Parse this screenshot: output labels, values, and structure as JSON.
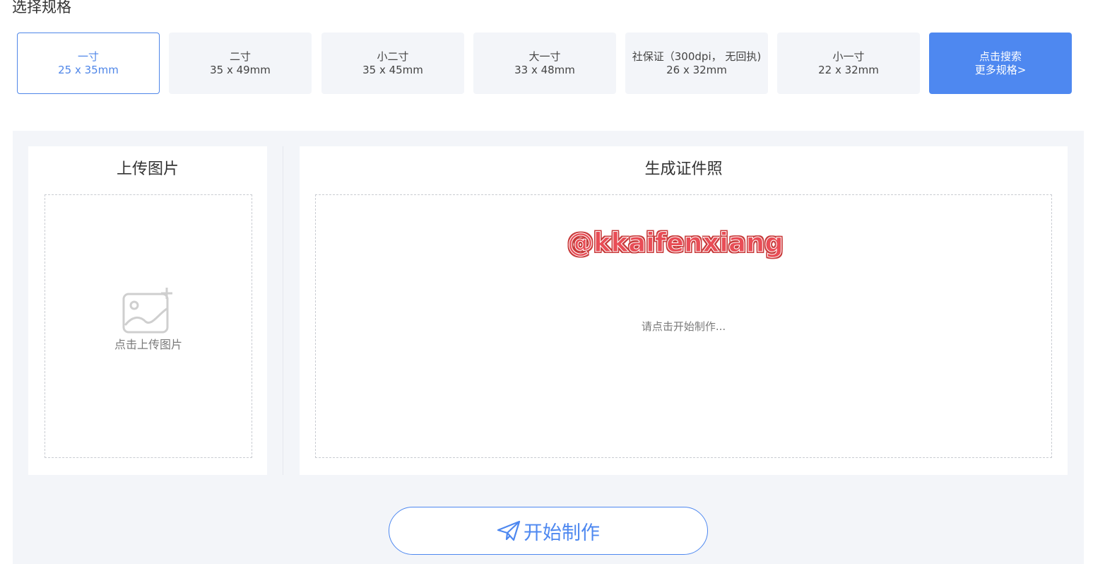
{
  "header": {
    "title": "选择规格"
  },
  "specs": [
    {
      "name": "一寸",
      "size": "25 x 35mm"
    },
    {
      "name": "二寸",
      "size": "35 x 49mm"
    },
    {
      "name": "小二寸",
      "size": "35 x 45mm"
    },
    {
      "name": "大一寸",
      "size": "33 x 48mm"
    },
    {
      "name": "社保证（300dpi， 无回执)",
      "size": "26 x 32mm"
    },
    {
      "name": "小一寸",
      "size": "22 x 32mm"
    }
  ],
  "more_specs": {
    "line1": "点击搜索",
    "line2": "更多规格>"
  },
  "upload_panel": {
    "title": "上传图片",
    "hint": "点击上传图片",
    "icon": "image-add-icon"
  },
  "result_panel": {
    "title": "生成证件照",
    "hint": "请点击开始制作...",
    "watermark": "@kkaifenxiang"
  },
  "start_button": {
    "label": "开始制作",
    "icon": "paper-plane-icon"
  },
  "colors": {
    "accent": "#4e88f0",
    "panel_bg": "#f3f5f9",
    "watermark": "#e94d56"
  }
}
